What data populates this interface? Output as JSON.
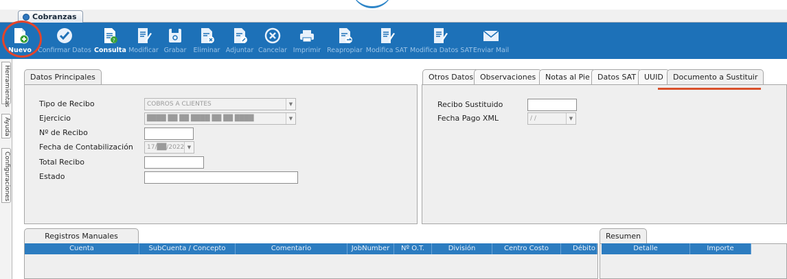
{
  "window": {
    "tab_label": "Cobranzas"
  },
  "toolbar": {
    "buttons": [
      {
        "label": "Nuevo",
        "icon": "new-document-icon",
        "enabled": true
      },
      {
        "label": "Confirmar Datos",
        "icon": "check-circle-icon",
        "enabled": false
      },
      {
        "label": "Consulta",
        "icon": "query-document-icon",
        "enabled": true
      },
      {
        "label": "Modificar",
        "icon": "edit-document-icon",
        "enabled": false
      },
      {
        "label": "Grabar",
        "icon": "save-icon",
        "enabled": false
      },
      {
        "label": "Eliminar",
        "icon": "delete-document-icon",
        "enabled": false
      },
      {
        "label": "Adjuntar",
        "icon": "attach-document-icon",
        "enabled": false
      },
      {
        "label": "Cancelar",
        "icon": "cancel-circle-icon",
        "enabled": false
      },
      {
        "label": "Imprimir",
        "icon": "printer-icon",
        "enabled": false
      },
      {
        "label": "Reapropiar",
        "icon": "reassign-document-icon",
        "enabled": false
      },
      {
        "label": "Modifica SAT",
        "icon": "edit-sat-icon",
        "enabled": false
      },
      {
        "label": "Modifica Datos SAT",
        "icon": "edit-sat-data-icon",
        "enabled": false
      },
      {
        "label": "Enviar Mail",
        "icon": "mail-icon",
        "enabled": false
      }
    ]
  },
  "side_tabs": {
    "tools": "Herramientas",
    "help": "Ayuda",
    "settings": "Configuraciones"
  },
  "main_panel": {
    "tab": "Datos Principales",
    "fields": {
      "tipo_recibo": {
        "label": "Tipo de Recibo",
        "value": "COBROS A CLIENTES"
      },
      "ejercicio": {
        "label": "Ejercicio",
        "value": "████ ██ ██ ████ ██ ██ ████"
      },
      "numero_recibo": {
        "label": "Nº de Recibo",
        "value": ""
      },
      "fecha_contabilizacion": {
        "label": "Fecha de Contabilización",
        "value": "17/██/2022"
      },
      "total_recibo": {
        "label": "Total Recibo",
        "value": ""
      },
      "estado": {
        "label": "Estado",
        "value": ""
      }
    }
  },
  "right_panel": {
    "tabs": [
      "Otros Datos",
      "Observaciones",
      "Notas al Pie",
      "Datos SAT",
      "UUID",
      "Documento a Sustituir"
    ],
    "selected_tab": "Documento a Sustituir",
    "fields": {
      "recibo_sustituido": {
        "label": "Recibo Sustituido",
        "value": ""
      },
      "fecha_pago_xml": {
        "label": "Fecha Pago XML",
        "value": "/ /"
      }
    }
  },
  "manual_records": {
    "tab": "Registros Manuales",
    "columns": [
      "Cuenta",
      "SubCuenta / Concepto",
      "Comentario",
      "JobNumber",
      "Nº O.T.",
      "División",
      "Centro Costo",
      "Débito"
    ]
  },
  "summary": {
    "tab": "Resumen",
    "columns": [
      "Detalle",
      "Importe"
    ]
  },
  "colors": {
    "toolbar": "#1d71b8",
    "highlight": "#e4442a",
    "grid_header": "#2c7cc0"
  }
}
